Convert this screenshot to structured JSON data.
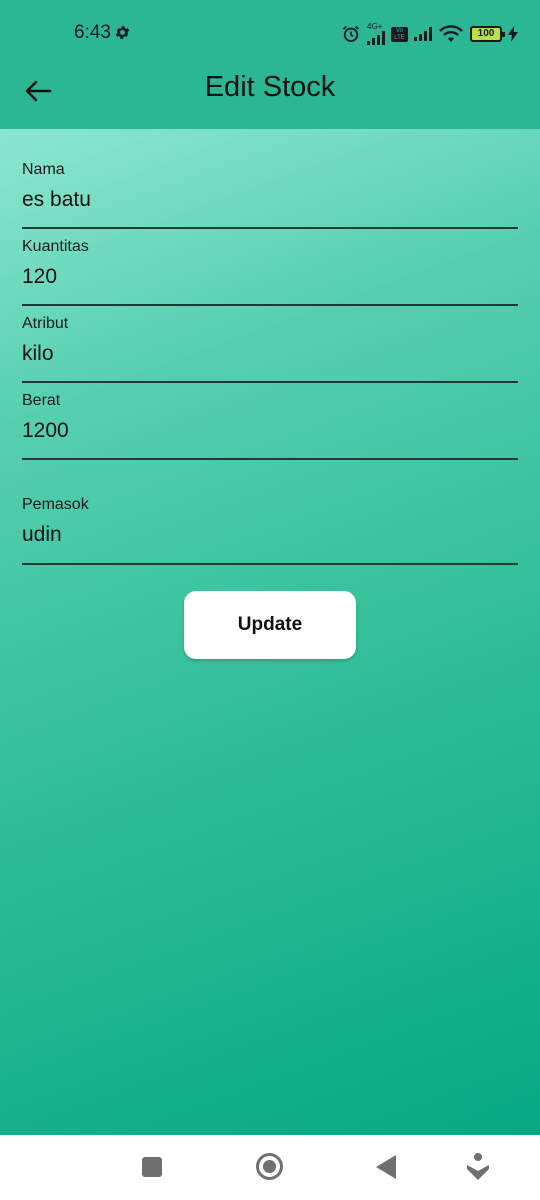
{
  "status_bar": {
    "time": "6:43",
    "network_label": "4G+",
    "volte_label": "Vo LTE",
    "battery": "100"
  },
  "app_bar": {
    "title": "Edit Stock"
  },
  "form": {
    "fields": [
      {
        "label": "Nama",
        "value": "es batu"
      },
      {
        "label": "Kuantitas",
        "value": "120"
      },
      {
        "label": "Atribut",
        "value": "kilo"
      },
      {
        "label": "Berat",
        "value": "1200"
      },
      {
        "label": "Pemasok",
        "value": "udin"
      }
    ],
    "submit_label": "Update"
  },
  "colors": {
    "app_bar": "#2bb794",
    "gradient_start": "#8ce6d0",
    "gradient_end": "#05a883"
  }
}
